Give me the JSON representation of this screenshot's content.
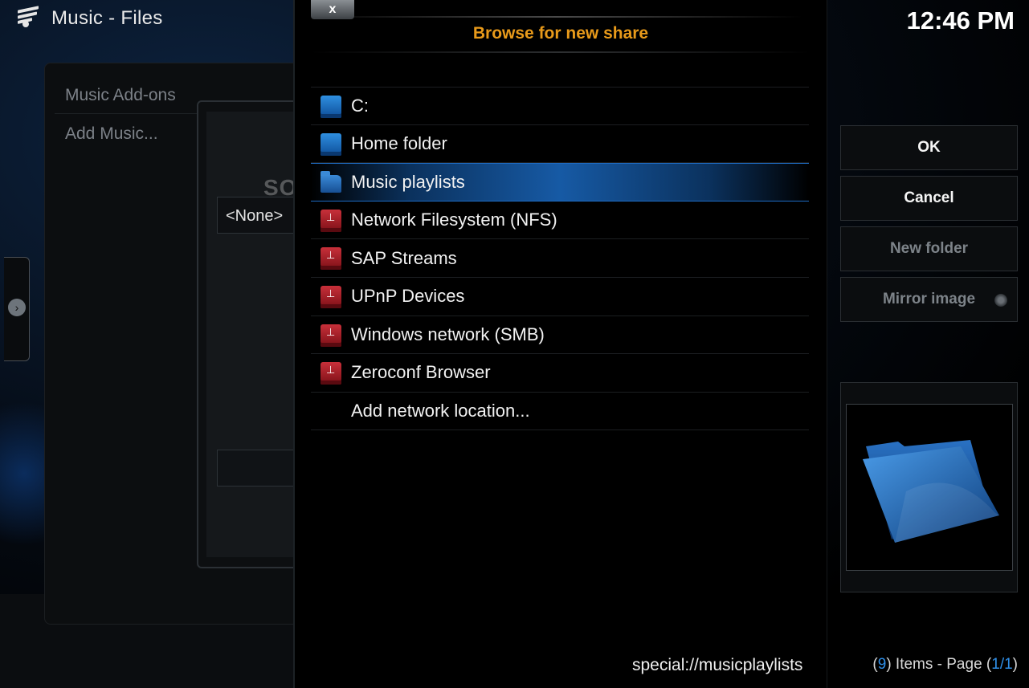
{
  "app": {
    "title": "Music - Files",
    "clock": "12:46 PM"
  },
  "menu": {
    "items": [
      "Music Add-ons",
      "Add Music..."
    ]
  },
  "add_source_dialog": {
    "dropdown_value": "<None>"
  },
  "browse_dialog": {
    "close_label": "x",
    "title": "Browse for new share",
    "items": [
      {
        "label": "C:",
        "icon": "drive-icon"
      },
      {
        "label": "Home folder",
        "icon": "drive-icon"
      },
      {
        "label": "Music playlists",
        "icon": "folder-icon",
        "selected": true
      },
      {
        "label": "Network Filesystem (NFS)",
        "icon": "network-drive-icon"
      },
      {
        "label": "SAP Streams",
        "icon": "network-drive-icon"
      },
      {
        "label": "UPnP Devices",
        "icon": "network-drive-icon"
      },
      {
        "label": "Windows network (SMB)",
        "icon": "network-drive-icon"
      },
      {
        "label": "Zeroconf Browser",
        "icon": "network-drive-icon"
      },
      {
        "label": "Add network location...",
        "icon": ""
      }
    ],
    "current_path": "special://musicplaylists"
  },
  "side_buttons": {
    "ok": "OK",
    "cancel": "Cancel",
    "new_folder": "New folder",
    "mirror_image": "Mirror image"
  },
  "footer": {
    "items_count": "9",
    "items_label": "Items - Page",
    "page": "1/1"
  },
  "watermark": "SOFTPEDIA",
  "colors": {
    "title_accent": "#e89a1a",
    "selection": "#1e78dc",
    "highlight_number": "#2f8fe8"
  }
}
